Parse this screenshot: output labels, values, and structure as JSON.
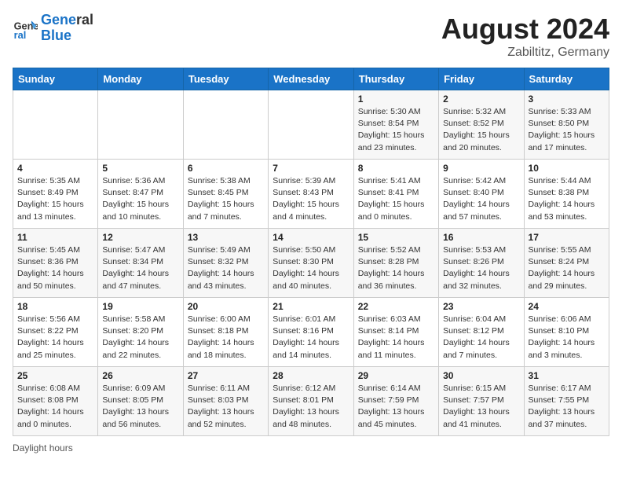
{
  "header": {
    "logo_line1": "General",
    "logo_line2": "Blue",
    "month_year": "August 2024",
    "location": "Zabiltitz, Germany"
  },
  "days_of_week": [
    "Sunday",
    "Monday",
    "Tuesday",
    "Wednesday",
    "Thursday",
    "Friday",
    "Saturday"
  ],
  "weeks": [
    [
      {
        "num": "",
        "info": ""
      },
      {
        "num": "",
        "info": ""
      },
      {
        "num": "",
        "info": ""
      },
      {
        "num": "",
        "info": ""
      },
      {
        "num": "1",
        "info": "Sunrise: 5:30 AM\nSunset: 8:54 PM\nDaylight: 15 hours\nand 23 minutes."
      },
      {
        "num": "2",
        "info": "Sunrise: 5:32 AM\nSunset: 8:52 PM\nDaylight: 15 hours\nand 20 minutes."
      },
      {
        "num": "3",
        "info": "Sunrise: 5:33 AM\nSunset: 8:50 PM\nDaylight: 15 hours\nand 17 minutes."
      }
    ],
    [
      {
        "num": "4",
        "info": "Sunrise: 5:35 AM\nSunset: 8:49 PM\nDaylight: 15 hours\nand 13 minutes."
      },
      {
        "num": "5",
        "info": "Sunrise: 5:36 AM\nSunset: 8:47 PM\nDaylight: 15 hours\nand 10 minutes."
      },
      {
        "num": "6",
        "info": "Sunrise: 5:38 AM\nSunset: 8:45 PM\nDaylight: 15 hours\nand 7 minutes."
      },
      {
        "num": "7",
        "info": "Sunrise: 5:39 AM\nSunset: 8:43 PM\nDaylight: 15 hours\nand 4 minutes."
      },
      {
        "num": "8",
        "info": "Sunrise: 5:41 AM\nSunset: 8:41 PM\nDaylight: 15 hours\nand 0 minutes."
      },
      {
        "num": "9",
        "info": "Sunrise: 5:42 AM\nSunset: 8:40 PM\nDaylight: 14 hours\nand 57 minutes."
      },
      {
        "num": "10",
        "info": "Sunrise: 5:44 AM\nSunset: 8:38 PM\nDaylight: 14 hours\nand 53 minutes."
      }
    ],
    [
      {
        "num": "11",
        "info": "Sunrise: 5:45 AM\nSunset: 8:36 PM\nDaylight: 14 hours\nand 50 minutes."
      },
      {
        "num": "12",
        "info": "Sunrise: 5:47 AM\nSunset: 8:34 PM\nDaylight: 14 hours\nand 47 minutes."
      },
      {
        "num": "13",
        "info": "Sunrise: 5:49 AM\nSunset: 8:32 PM\nDaylight: 14 hours\nand 43 minutes."
      },
      {
        "num": "14",
        "info": "Sunrise: 5:50 AM\nSunset: 8:30 PM\nDaylight: 14 hours\nand 40 minutes."
      },
      {
        "num": "15",
        "info": "Sunrise: 5:52 AM\nSunset: 8:28 PM\nDaylight: 14 hours\nand 36 minutes."
      },
      {
        "num": "16",
        "info": "Sunrise: 5:53 AM\nSunset: 8:26 PM\nDaylight: 14 hours\nand 32 minutes."
      },
      {
        "num": "17",
        "info": "Sunrise: 5:55 AM\nSunset: 8:24 PM\nDaylight: 14 hours\nand 29 minutes."
      }
    ],
    [
      {
        "num": "18",
        "info": "Sunrise: 5:56 AM\nSunset: 8:22 PM\nDaylight: 14 hours\nand 25 minutes."
      },
      {
        "num": "19",
        "info": "Sunrise: 5:58 AM\nSunset: 8:20 PM\nDaylight: 14 hours\nand 22 minutes."
      },
      {
        "num": "20",
        "info": "Sunrise: 6:00 AM\nSunset: 8:18 PM\nDaylight: 14 hours\nand 18 minutes."
      },
      {
        "num": "21",
        "info": "Sunrise: 6:01 AM\nSunset: 8:16 PM\nDaylight: 14 hours\nand 14 minutes."
      },
      {
        "num": "22",
        "info": "Sunrise: 6:03 AM\nSunset: 8:14 PM\nDaylight: 14 hours\nand 11 minutes."
      },
      {
        "num": "23",
        "info": "Sunrise: 6:04 AM\nSunset: 8:12 PM\nDaylight: 14 hours\nand 7 minutes."
      },
      {
        "num": "24",
        "info": "Sunrise: 6:06 AM\nSunset: 8:10 PM\nDaylight: 14 hours\nand 3 minutes."
      }
    ],
    [
      {
        "num": "25",
        "info": "Sunrise: 6:08 AM\nSunset: 8:08 PM\nDaylight: 14 hours\nand 0 minutes."
      },
      {
        "num": "26",
        "info": "Sunrise: 6:09 AM\nSunset: 8:05 PM\nDaylight: 13 hours\nand 56 minutes."
      },
      {
        "num": "27",
        "info": "Sunrise: 6:11 AM\nSunset: 8:03 PM\nDaylight: 13 hours\nand 52 minutes."
      },
      {
        "num": "28",
        "info": "Sunrise: 6:12 AM\nSunset: 8:01 PM\nDaylight: 13 hours\nand 48 minutes."
      },
      {
        "num": "29",
        "info": "Sunrise: 6:14 AM\nSunset: 7:59 PM\nDaylight: 13 hours\nand 45 minutes."
      },
      {
        "num": "30",
        "info": "Sunrise: 6:15 AM\nSunset: 7:57 PM\nDaylight: 13 hours\nand 41 minutes."
      },
      {
        "num": "31",
        "info": "Sunrise: 6:17 AM\nSunset: 7:55 PM\nDaylight: 13 hours\nand 37 minutes."
      }
    ]
  ],
  "footer": {
    "note": "Daylight hours"
  }
}
